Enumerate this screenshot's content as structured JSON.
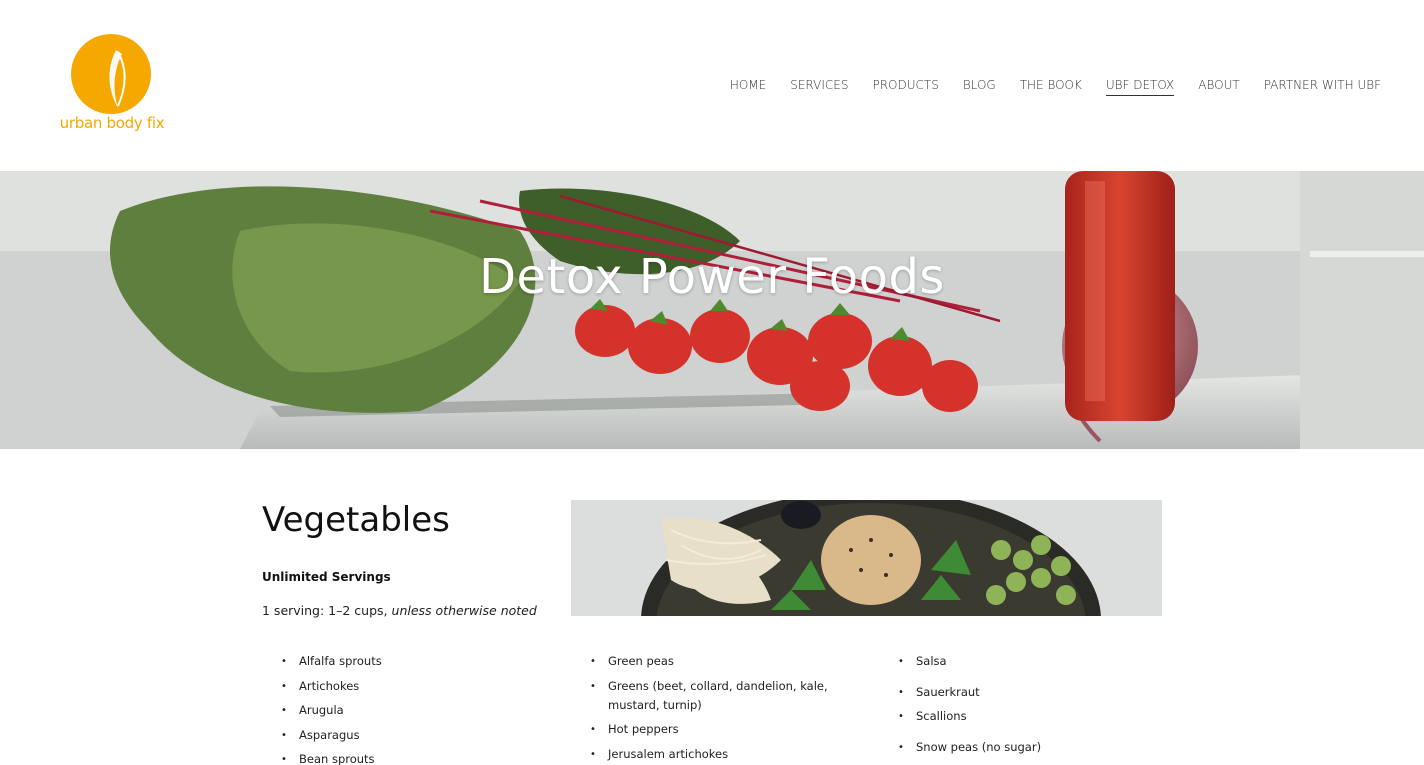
{
  "brand": {
    "name": "urban body fix",
    "accent": "#f5a800"
  },
  "nav": {
    "items": [
      {
        "label": "HOME",
        "active": false
      },
      {
        "label": "SERVICES",
        "active": false
      },
      {
        "label": "PRODUCTS",
        "active": false
      },
      {
        "label": "BLOG",
        "active": false
      },
      {
        "label": "THE BOOK",
        "active": false
      },
      {
        "label": "UBF DETOX",
        "active": true
      },
      {
        "label": "ABOUT",
        "active": false
      },
      {
        "label": "PARTNER WITH UBF",
        "active": false
      }
    ]
  },
  "hero": {
    "title": "Detox Power Foods"
  },
  "section": {
    "title": "Vegetables",
    "subtitle": "Unlimited Servings",
    "serving_prefix": "1 serving: 1–2 cups,",
    "serving_note": "unless otherwise noted"
  },
  "lists": {
    "col1": [
      "Alfalfa sprouts",
      "Artichokes",
      "Arugula",
      "Asparagus",
      "Bean sprouts"
    ],
    "col2": [
      "Green peas",
      "Greens (beet, collard, dandelion, kale, mustard, turnip)",
      "Hot peppers",
      "Jerusalem artichokes"
    ],
    "col3": [
      "Salsa",
      "Sauerkraut",
      "Scallions",
      "Snow peas (no sugar)"
    ]
  }
}
